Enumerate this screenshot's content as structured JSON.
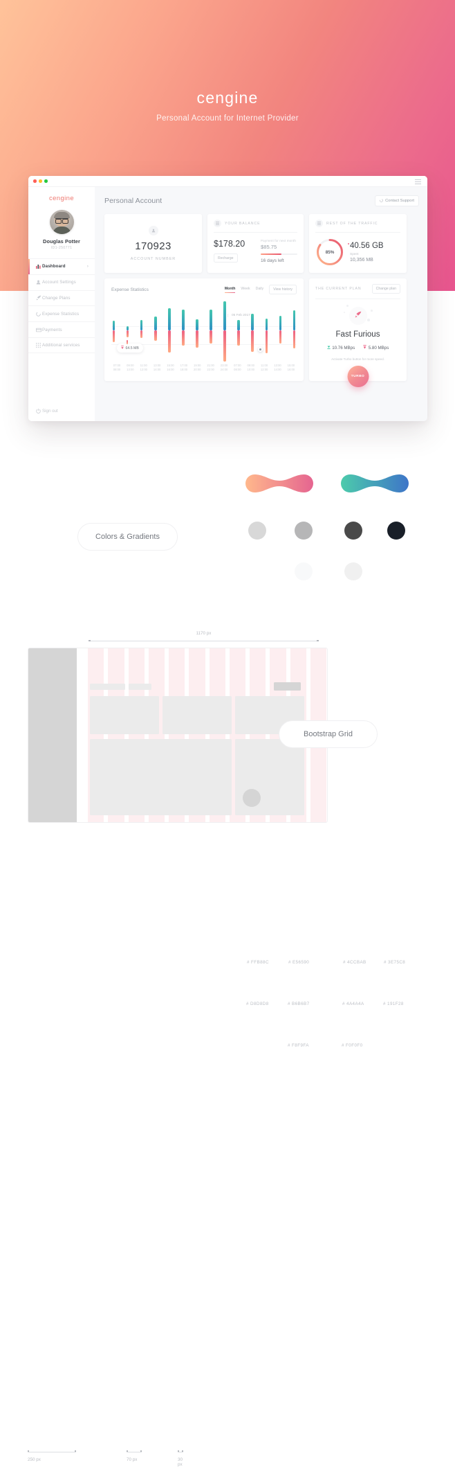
{
  "hero": {
    "logo": "cengine",
    "subtitle": "Personal Account for Internet Provider"
  },
  "window": {
    "sidebar": {
      "logo": "cengine",
      "user_name": "Douglas Potter",
      "user_id": "ID1-250771",
      "items": [
        {
          "label": "Dashboard",
          "icon": "bar-chart-icon",
          "active": true
        },
        {
          "label": "Account Settings",
          "icon": "user-icon",
          "active": false
        },
        {
          "label": "Change Plans",
          "icon": "rocket-icon",
          "active": false
        },
        {
          "label": "Expense Statistics",
          "icon": "pie-chart-icon",
          "active": false
        },
        {
          "label": "Payments",
          "icon": "credit-card-icon",
          "active": false
        },
        {
          "label": "Additional services",
          "icon": "grid-icon",
          "active": false
        }
      ],
      "sign_out": "Sign out"
    },
    "header": {
      "title": "Personal Account",
      "support_button": "Contact Support"
    },
    "account_card": {
      "number": "170923",
      "label": "ACCOUNT NUMBER"
    },
    "balance_card": {
      "label": "YOUR BALANCE",
      "amount": "$178.20",
      "recharge_button": "Recharge",
      "next_payment_label": "Payment for next month",
      "next_payment_amount": "$85.75",
      "days_left": "16 days left",
      "progress_pct": 56
    },
    "traffic_card": {
      "label": "REST OF THE TRAFFIC",
      "percent_text": "85%",
      "percent": 85,
      "remaining": "40.56 GB",
      "spent_label": "Spent",
      "spent_value": "10,356 MB"
    },
    "chart_card": {
      "title": "Expense Statistics",
      "segments": [
        "Month",
        "Week",
        "Daily"
      ],
      "active_segment": "Month",
      "view_history_button": "View history",
      "date_chip": "05 Feb 2017",
      "tooltip_value": "64.5 MB"
    },
    "plan_card": {
      "label": "THE CURRENT PLAN",
      "change_button": "Change plan",
      "name": "Fast Furious",
      "download_speed": "10.76 MBps",
      "upload_speed": "5.80 MBps",
      "note": "Activate Turbo button for more speed.",
      "turbo_button": "TURBO"
    }
  },
  "chart_data": {
    "type": "bar",
    "title": "Expense Statistics",
    "xlabel": "",
    "ylabel": "",
    "categories": [
      "07:00 08:00",
      "09:00 13:00",
      "11:00 12:00",
      "13:00 14:00",
      "15:00 16:00",
      "17:00 18:00",
      "19:00 20:00",
      "21:00 22:00",
      "23:00 24:00",
      "07:00 08:00",
      "09:00 10:00",
      "11:00 12:00",
      "13:00 14:00",
      "15:00 16:00"
    ],
    "series": [
      {
        "name": "Download",
        "color": "#2f8fc4",
        "values": [
          22,
          10,
          24,
          32,
          52,
          48,
          26,
          48,
          68,
          24,
          38,
          28,
          34,
          46
        ]
      },
      {
        "name": "Upload",
        "color": "#ec5f83",
        "values": [
          28,
          16,
          18,
          24,
          52,
          36,
          40,
          30,
          72,
          36,
          50,
          54,
          30,
          42
        ]
      }
    ],
    "annotation": "64.5 MB",
    "date_label": "05 Feb 2017",
    "grid": true,
    "legend": "none"
  },
  "palette": {
    "pill_label": "Colors & Gradients",
    "gradients": [
      {
        "from": "#FFB88C",
        "to": "#E56590",
        "from_label": "# FFB88C",
        "to_label": "# E56590"
      },
      {
        "from": "#4CCBAB",
        "to": "#3E75C8",
        "from_label": "# 4CCBAB",
        "to_label": "# 3E75C8"
      }
    ],
    "swatches": [
      {
        "hex": "#D8D8D8",
        "label": "# D8D8D8"
      },
      {
        "hex": "#B6B6B7",
        "label": "# B6B6B7"
      },
      {
        "hex": "#4A4A4A",
        "label": "# 4A4A4A"
      },
      {
        "hex": "#191F28",
        "label": "# 191F28"
      },
      {
        "hex": "#F8F9FA",
        "label": "# F8F9FA"
      },
      {
        "hex": "#F0F0F0",
        "label": "# F0F0F0"
      }
    ]
  },
  "grid_section": {
    "pill_label": "Bootstrap Grid",
    "width_label": "1170 px",
    "measures": [
      {
        "label": "250 px",
        "width": 70
      },
      {
        "label": "70 px",
        "width": 22
      },
      {
        "label": "30 px",
        "width": 8
      }
    ]
  }
}
